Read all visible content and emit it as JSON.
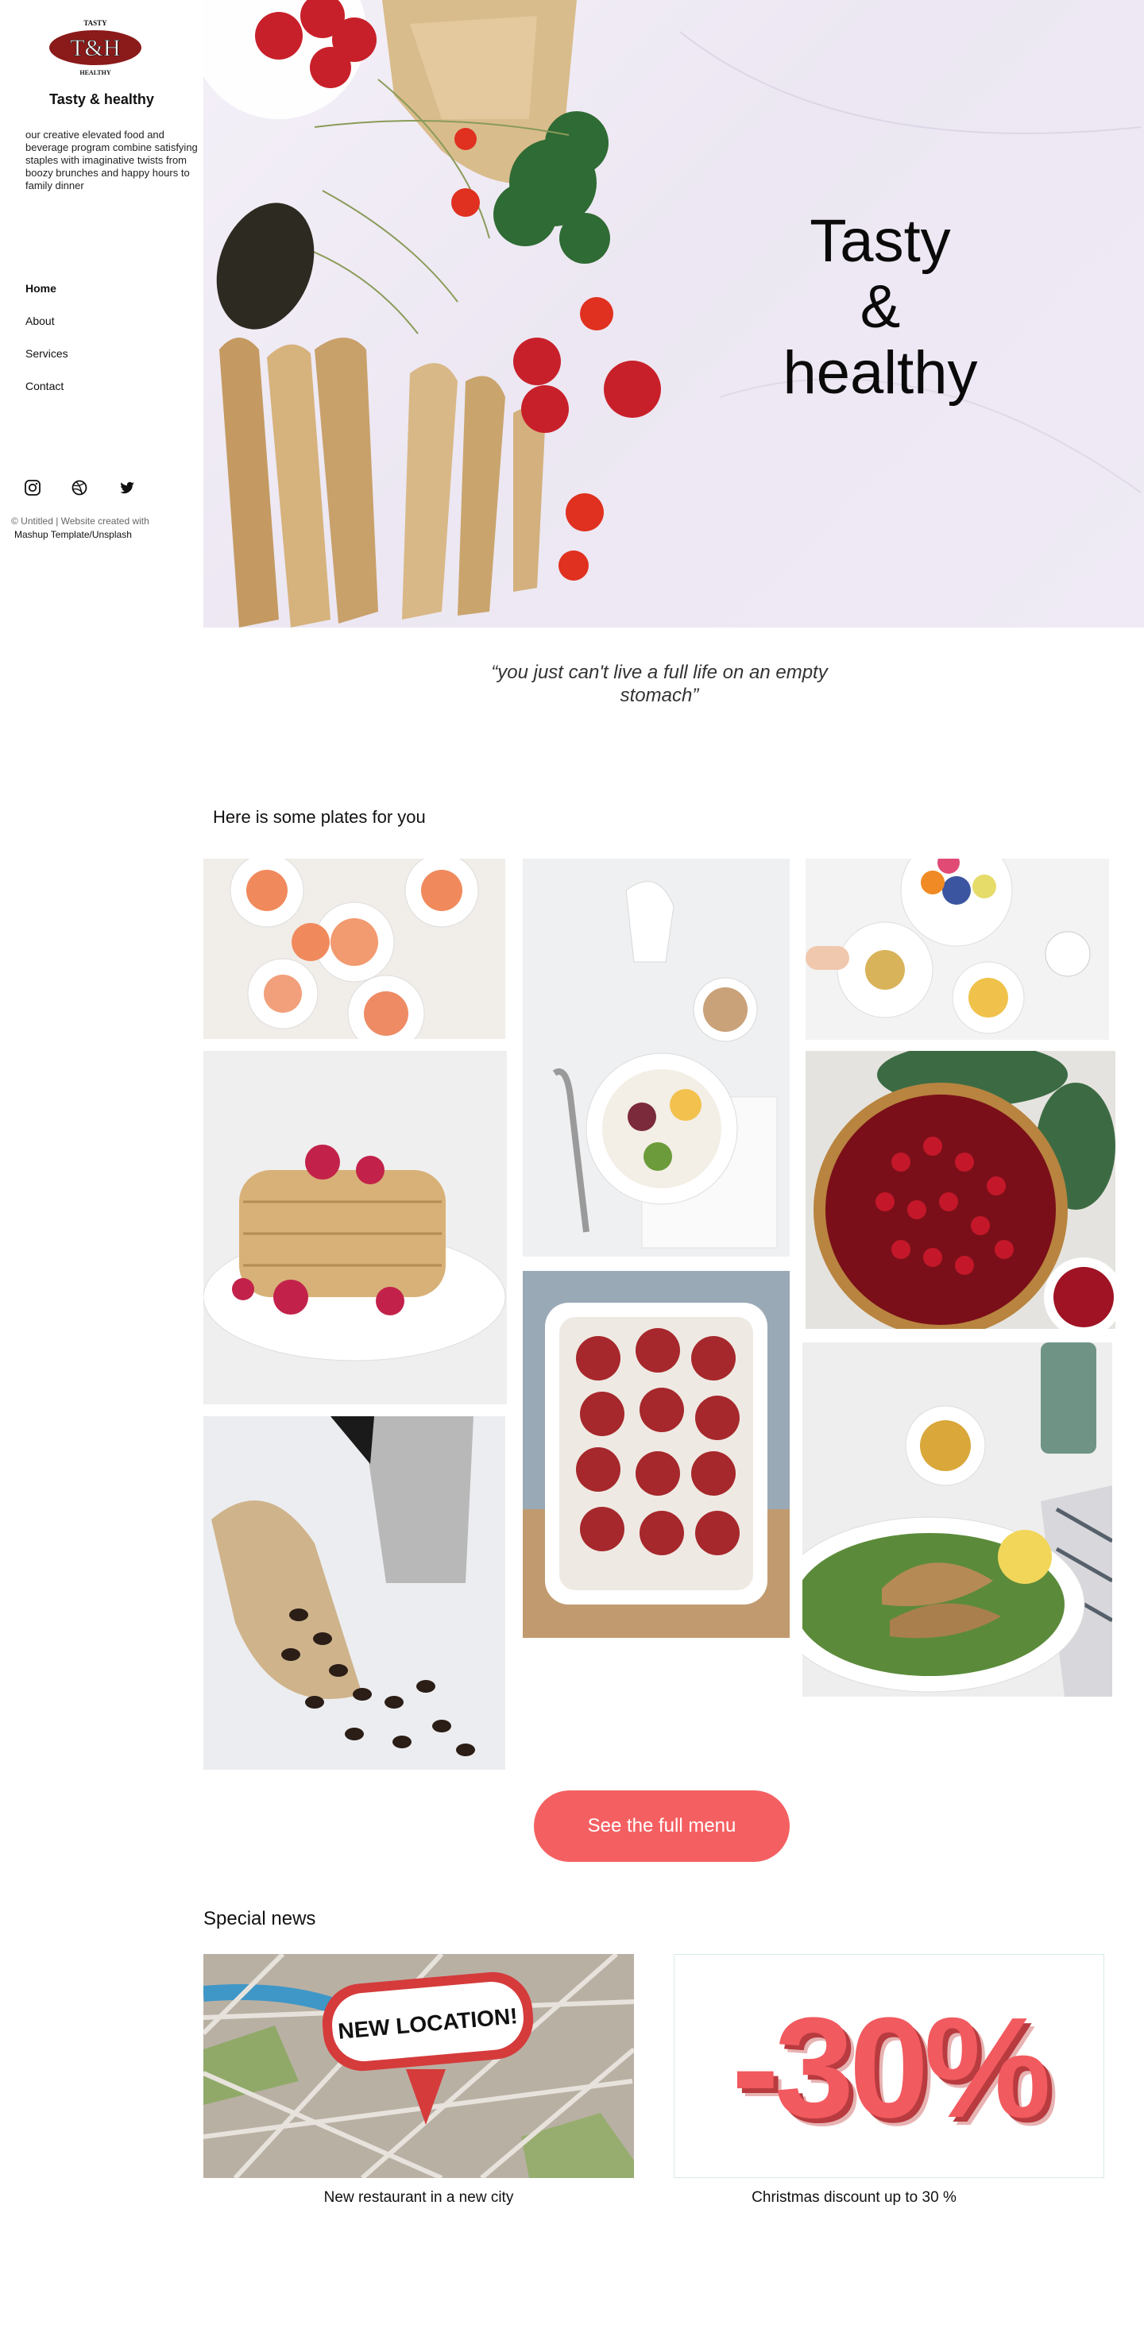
{
  "logo": {
    "small_top": "TASTY",
    "monogram": "T&H",
    "small_bottom": "HEALTHY"
  },
  "sidebar": {
    "brand_name": "Tasty & healthy",
    "tagline": "our creative elevated food and beverage program combine satisfying staples with imaginative twists from boozy brunches and happy hours to family dinner",
    "nav": [
      {
        "label": "Home",
        "active": true
      },
      {
        "label": "About",
        "active": false
      },
      {
        "label": "Services",
        "active": false
      },
      {
        "label": "Contact",
        "active": false
      }
    ],
    "social_icons": [
      "instagram-icon",
      "dribbble-icon",
      "twitter-icon"
    ],
    "footer_text": "© Untitled | Website created with",
    "footer_link": "Mashup Template/Unsplash"
  },
  "hero": {
    "title_line1": "Tasty",
    "title_line2": "&",
    "title_line3": "healthy"
  },
  "quote": "“you just can't live a full life on an empty stomach”",
  "plates": {
    "heading": "Here is some plates for you"
  },
  "cta": {
    "label": "See the full menu"
  },
  "news": {
    "heading": "Special news",
    "items": [
      {
        "badge": "NEW LOCATION!",
        "caption": "New restaurant in a new city"
      },
      {
        "badge": "-30%",
        "caption": "Christmas discount up to 30 %"
      }
    ]
  },
  "colors": {
    "accent": "#f46062",
    "logo_red": "#8b1a1a",
    "text": "#111111"
  }
}
